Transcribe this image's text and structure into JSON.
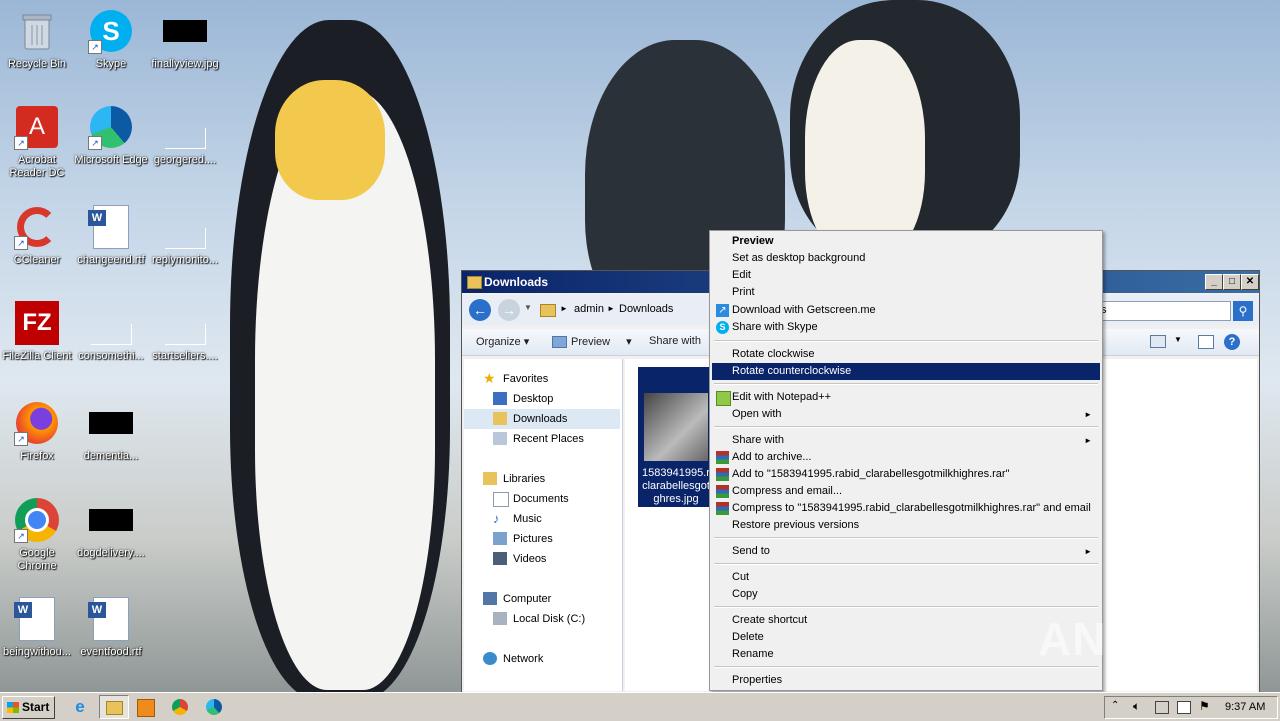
{
  "desktop": {
    "icons": [
      {
        "label": "Recycle Bin",
        "icon": "recycle-bin-icon"
      },
      {
        "label": "Skype",
        "icon": "skype-icon"
      },
      {
        "label": "finallyview.jpg",
        "icon": "image-file-icon"
      },
      {
        "label": "Acrobat Reader DC",
        "icon": "acrobat-icon"
      },
      {
        "label": "Microsoft Edge",
        "icon": "edge-icon"
      },
      {
        "label": "georgered....",
        "icon": "blank-file-icon"
      },
      {
        "label": "CCleaner",
        "icon": "ccleaner-icon"
      },
      {
        "label": "changeend.rtf",
        "icon": "word-doc-icon"
      },
      {
        "label": "replymonito...",
        "icon": "blank-file-icon"
      },
      {
        "label": "FileZilla Client",
        "icon": "filezilla-icon"
      },
      {
        "label": "consomethi...",
        "icon": "blank-file-icon"
      },
      {
        "label": "startseliers....",
        "icon": "blank-file-icon"
      },
      {
        "label": "Firefox",
        "icon": "firefox-icon"
      },
      {
        "label": "dementia...",
        "icon": "image-file-icon"
      },
      {
        "label": "Google Chrome",
        "icon": "chrome-icon"
      },
      {
        "label": "dogdelivery....",
        "icon": "image-file-icon"
      },
      {
        "label": "beingwithou...",
        "icon": "word-doc-icon"
      },
      {
        "label": "eventfood.rtf",
        "icon": "word-doc-icon"
      }
    ]
  },
  "explorer": {
    "title": "Downloads",
    "breadcrumb": [
      "admin",
      "Downloads"
    ],
    "search_partial": "s",
    "toolbar": {
      "organize": "Organize",
      "preview": "Preview",
      "share_with": "Share with"
    },
    "nav": {
      "favorites": "Favorites",
      "favorites_items": [
        "Desktop",
        "Downloads",
        "Recent Places"
      ],
      "libraries": "Libraries",
      "libraries_items": [
        "Documents",
        "Music",
        "Pictures",
        "Videos"
      ],
      "computer": "Computer",
      "computer_items": [
        "Local Disk (C:)"
      ],
      "network": "Network"
    },
    "file": {
      "name_lines": [
        "1583941995.r",
        "clarabellesgot",
        "ghres.jpg"
      ]
    }
  },
  "context_menu": {
    "items": [
      {
        "label": "Preview",
        "bold": true
      },
      {
        "label": "Set as desktop background"
      },
      {
        "label": "Edit"
      },
      {
        "label": "Print"
      },
      {
        "label": "Download with Getscreen.me",
        "icon": "getscreen-icon"
      },
      {
        "label": "Share with Skype",
        "icon": "skype-icon"
      },
      {
        "label": "Rotate clockwise"
      },
      {
        "label": "Rotate counterclockwise",
        "highlighted": true
      },
      {
        "label": "Edit with Notepad++",
        "icon": "notepadpp-icon"
      },
      {
        "label": "Open with",
        "submenu": true
      },
      {
        "label": "Share with",
        "submenu": true
      },
      {
        "label": "Add to archive...",
        "icon": "winrar-icon"
      },
      {
        "label": "Add to \"1583941995.rabid_clarabellesgotmilkhighres.rar\"",
        "icon": "winrar-icon"
      },
      {
        "label": "Compress and email...",
        "icon": "winrar-icon"
      },
      {
        "label": "Compress to \"1583941995.rabid_clarabellesgotmilkhighres.rar\" and email",
        "icon": "winrar-icon"
      },
      {
        "label": "Restore previous versions"
      },
      {
        "label": "Send to",
        "submenu": true
      },
      {
        "label": "Cut"
      },
      {
        "label": "Copy"
      },
      {
        "label": "Create shortcut"
      },
      {
        "label": "Delete"
      },
      {
        "label": "Rename"
      },
      {
        "label": "Properties"
      }
    ]
  },
  "taskbar": {
    "start": "Start",
    "clock": "9:37 AM"
  },
  "watermark": "ANY RUN",
  "colors": {
    "highlight": "#0a246a",
    "titlebar": "#0a246a",
    "taskbar": "#d4d0c8"
  }
}
